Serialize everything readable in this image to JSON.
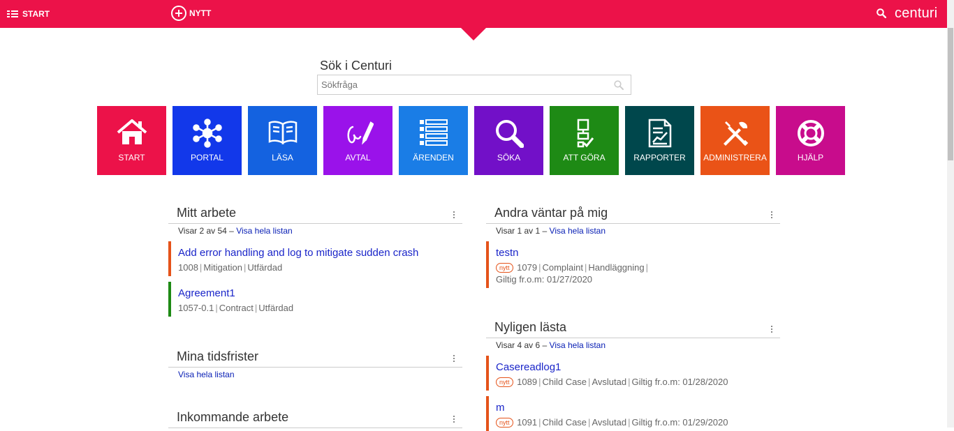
{
  "topbar": {
    "start_label": "START",
    "new_label": "NYTT",
    "brand": "centuri",
    "accent": "#ec1249"
  },
  "search": {
    "label": "Sök i Centuri",
    "placeholder": "Sökfråga"
  },
  "tiles": [
    {
      "label": "START",
      "color": "#ec1249",
      "icon": "home-icon"
    },
    {
      "label": "PORTAL",
      "color": "#1238ea",
      "icon": "network-icon"
    },
    {
      "label": "LÄSA",
      "color": "#1462e0",
      "icon": "book-icon"
    },
    {
      "label": "AVTAL",
      "color": "#9a12ea",
      "icon": "signature-icon"
    },
    {
      "label": "ÄRENDEN",
      "color": "#1a7de6",
      "icon": "list-icon"
    },
    {
      "label": "SÖKA",
      "color": "#7210c8",
      "icon": "magnifier-icon"
    },
    {
      "label": "ATT GÖRA",
      "color": "#1e8a15",
      "icon": "checklist-icon"
    },
    {
      "label": "RAPPORTER",
      "color": "#00474c",
      "icon": "report-icon"
    },
    {
      "label": "ADMINISTRERA",
      "color": "#ea5317",
      "icon": "tools-icon"
    },
    {
      "label": "HJÄLP",
      "color": "#c80c8c",
      "icon": "lifebuoy-icon"
    }
  ],
  "mitt_arbete": {
    "title": "Mitt arbete",
    "count": "Visar 2 av 54",
    "dash": "–",
    "link": "Visa hela listan",
    "items": [
      {
        "title": "Add error handling and log to mitigate sudden crash",
        "id": "1008",
        "type": "Mitigation",
        "status": "Utfärdad"
      },
      {
        "title": "Agreement1",
        "id": "1057-0.1",
        "type": "Contract",
        "status": "Utfärdad"
      }
    ]
  },
  "tidsfrister": {
    "title": "Mina tidsfrister",
    "link": "Visa hela listan"
  },
  "inkommande": {
    "title": "Inkommande arbete"
  },
  "andra": {
    "title": "Andra väntar på mig",
    "count": "Visar 1 av 1",
    "dash": "–",
    "link": "Visa hela listan",
    "items": [
      {
        "title": "testn",
        "badge": "nytt",
        "id": "1079",
        "type": "Complaint",
        "status": "Handläggning",
        "valid": "Giltig fr.o.m: 01/27/2020"
      }
    ]
  },
  "nyligen": {
    "title": "Nyligen lästa",
    "count": "Visar 4 av 6",
    "dash": "–",
    "link": "Visa hela listan",
    "items": [
      {
        "title": "Casereadlog1",
        "badge": "nytt",
        "id": "1089",
        "type": "Child Case",
        "status": "Avslutad",
        "valid": "Giltig fr.o.m: 01/28/2020"
      },
      {
        "title": "m",
        "badge": "nytt",
        "id": "1091",
        "type": "Child Case",
        "status": "Avslutad",
        "valid": "Giltig fr.o.m: 01/29/2020"
      }
    ]
  }
}
